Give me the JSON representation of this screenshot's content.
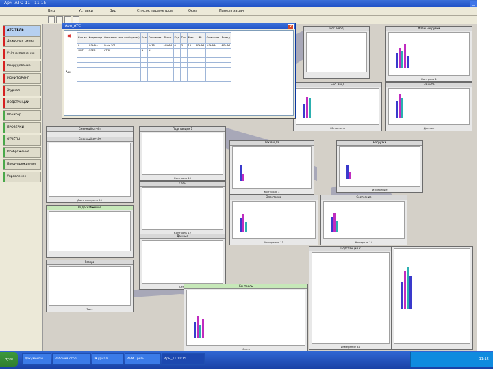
{
  "window": {
    "title": "Арм_АТС_11 - 11:15"
  },
  "menu": [
    "Вид",
    "Уставки",
    "Вид",
    "Список параметров",
    "Окна",
    "Панель задач"
  ],
  "sidebar": {
    "header": "АТС ТЕЛЬ",
    "items": [
      "Дежурная смена",
      "Учёт исполнения",
      "Оборудование",
      "МОНИТОРИНГ",
      "Журнал",
      "ПОДСТАНЦИИ",
      "Монитор",
      "ПРОВЕРКИ",
      "ОТЧЁТЫ",
      "Отображение",
      "Предупреждения",
      "Управление"
    ]
  },
  "dialog": {
    "title": "Арм_АТС",
    "headers": [
      "Кол-во",
      "Код ввода",
      "Описание (тип сообщения)",
      "Кол",
      "Описание",
      "Всего",
      "Код",
      "Тип",
      "Мин",
      "Иб",
      "Описание",
      "Вывод"
    ],
    "rows": [
      [
        "0",
        "АЛЬФА",
        "Учёт 101",
        "",
        "5435",
        "АЛЬФА",
        "0",
        "3",
        "15",
        "АЛЬФА",
        "АЛЬФА",
        "АЛЬФА"
      ],
      [
        "ЛОТ",
        "ОЗЕР",
        "СТРУ",
        "Н",
        "Н",
        "",
        "",
        "",
        "",
        "",
        "",
        ""
      ]
    ],
    "side_label": "Арм"
  },
  "panels": [
    {
      "title": "Сменный отчёт",
      "footer": "Дата контроля 20"
    },
    {
      "title": "Фазы нагрузки",
      "footer": "Контроль 1"
    },
    {
      "title": "Бос. Ввод",
      "footer": "Обновлено"
    },
    {
      "title": "Защита",
      "footer": "Данные"
    },
    {
      "title": "Подстанция 1",
      "footer": "Контроль 10"
    },
    {
      "title": "Ток ввода",
      "footer": "Контроль 3"
    },
    {
      "title": "Нагрузки",
      "footer": "Измерение"
    },
    {
      "title": "Сеть",
      "footer": "Контроль 12"
    },
    {
      "title": "Водоснабжение",
      "footer": "Контроль 7"
    },
    {
      "title": "Электрика",
      "footer": "Измерения 11"
    },
    {
      "title": "Состояние",
      "footer": "Контроль 14"
    },
    {
      "title": "Данные",
      "footer": "Сеть"
    },
    {
      "title": "Резерв",
      "footer": "Тест"
    },
    {
      "title": "Подстанция 2",
      "footer": "Измерение 44"
    },
    {
      "title": "Контроль",
      "footer": "Уровень"
    },
    {
      "title": "Отчёт",
      "footer": "Итого"
    }
  ],
  "taskbar": {
    "start": "пуск",
    "tasks": [
      "Документы",
      "Рабочий стол",
      "Журнал",
      "АРМ Треть",
      "Арм_11 11:15"
    ],
    "clock": "11:15"
  },
  "colors": {
    "bar1": "#3a3acc",
    "bar2": "#c02cc0",
    "bar3": "#2cb0b0",
    "bar4": "#d62020"
  }
}
